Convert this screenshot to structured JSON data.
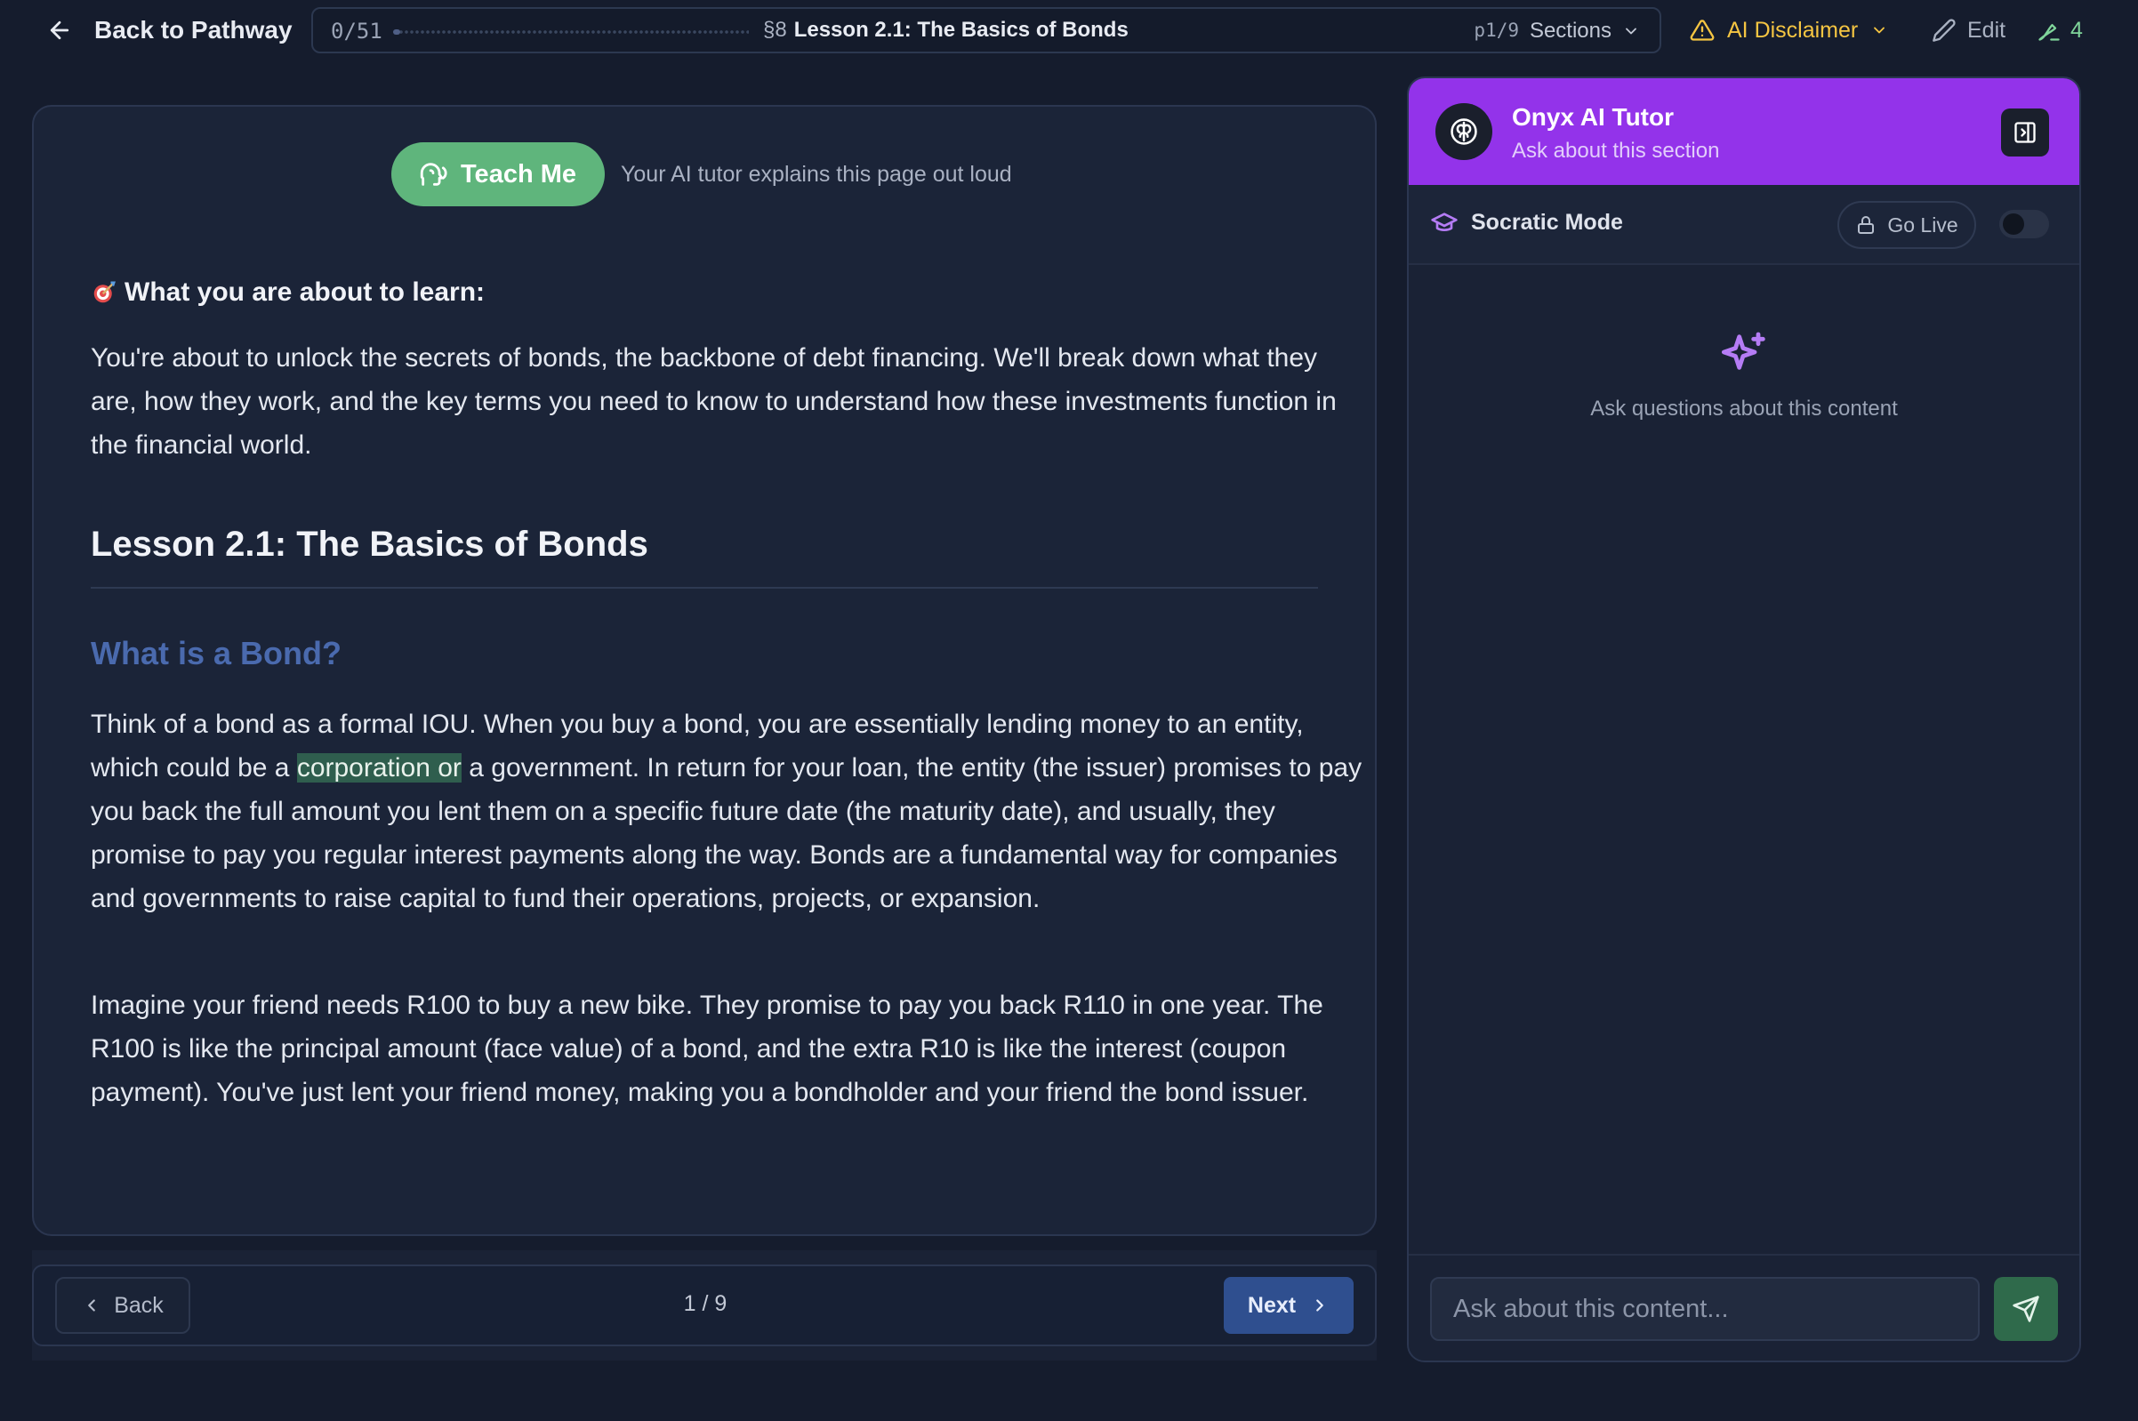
{
  "topbar": {
    "back_label": "Back to Pathway",
    "progress_count": "0/51",
    "progress_fraction": 0.02,
    "section_number": "§8",
    "lesson_title": "Lesson 2.1: The Basics of Bonds",
    "page_indicator": "p1/9",
    "sections_label": "Sections",
    "disclaimer_label": "AI Disclaimer",
    "edit_label": "Edit",
    "signature_count": "4"
  },
  "content": {
    "teach_button_label": "Teach Me",
    "teach_hint": "Your AI tutor explains this page out loud",
    "learn_heading": "What you are about to learn:",
    "learn_text": "You're about to unlock the secrets of bonds, the backbone of debt financing. We'll break down what they are, how they work, and the key terms you need to know to understand how these investments function in the financial world.",
    "lesson_heading": "Lesson 2.1: The Basics of Bonds",
    "subheading": "What is a Bond?",
    "para1_before": "Think of a bond as a formal IOU. When you buy a bond, you are essentially lending money to an entity, which could be a ",
    "para1_highlight": "corporation or",
    "para1_after": " a government. In return for your loan, the entity (the issuer) promises to pay you back the full amount you lent them on a specific future date (the maturity date), and usually, they promise to pay you regular interest payments along the way. Bonds are a fundamental way for companies and governments to raise capital to fund their operations, projects, or expansion.",
    "para2": "Imagine your friend needs R100 to buy a new bike. They promise to pay you back R110 in one year. The R100 is like the principal amount (face value) of a bond, and the extra R10 is like the interest (coupon payment). You've just lent your friend money, making you a bondholder and your friend the bond issuer."
  },
  "pager": {
    "back_label": "Back",
    "page_label": "1 / 9",
    "next_label": "Next"
  },
  "tutor": {
    "name": "Onyx AI Tutor",
    "subtitle": "Ask about this section",
    "socratic_label": "Socratic Mode",
    "golive_label": "Go Live",
    "socratic_enabled": false,
    "empty_text": "Ask questions about this content",
    "input_placeholder": "Ask about this content..."
  },
  "colors": {
    "background": "#151c2d",
    "card": "#1b2438",
    "teach_green": "#5fb57c",
    "tutor_purple": "#9333ea",
    "next_blue": "#2f4f8f",
    "disclaimer_yellow": "#f5c542",
    "subheading_blue": "#4a6aae",
    "send_green": "#2f6a4b"
  },
  "icons": {
    "back": "arrow-left-icon",
    "sections": "chevron-down-icon",
    "disclaimer": "warning-triangle-icon",
    "edit": "pencil-icon",
    "signature": "signature-icon",
    "teach": "speaking-head-icon",
    "learn": "target-icon",
    "tutor_logo": "brain-icon",
    "collapse": "panel-collapse-icon",
    "socratic": "graduation-cap-icon",
    "golive": "lock-icon",
    "empty": "sparkles-icon",
    "send": "send-icon"
  }
}
